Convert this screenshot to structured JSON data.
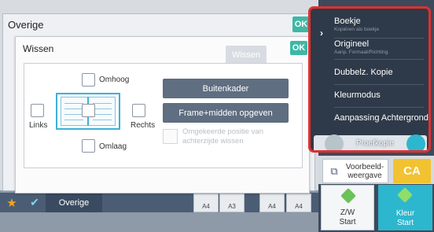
{
  "overige_panel": {
    "title": "Overige",
    "ok_label": "OK"
  },
  "wissen_dialog": {
    "title": "Wissen",
    "wissen_button": "Wissen",
    "ok_label": "OK",
    "checkboxes": {
      "top": "Omhoog",
      "left": "Links",
      "right": "Rechts",
      "bottom": "Omlaag"
    },
    "buttons": {
      "frame": "Buitenkader",
      "frame_center": "Frame+midden opgeven"
    },
    "reverse_side_label": "Omgekeerde positie van achterzijde wissen"
  },
  "menu": {
    "items": [
      {
        "label": "Boekje",
        "sub": "Kopiëren als boekje"
      },
      {
        "label": "Origineel",
        "sub": "Aanp. Formaat/Richting."
      },
      {
        "label": "Dubbelz. Kopie",
        "sub": ""
      },
      {
        "label": "Kleurmodus",
        "sub": ""
      },
      {
        "label": "Aanpassing Achtergrond",
        "sub": ""
      }
    ],
    "proof_label": "Proefkopie",
    "highlight_color": "#e0302f"
  },
  "right_panel": {
    "preview_label": "Voorbeeld-weergave",
    "ca_label": "CA",
    "start_bw_label": "Z/W\nStart",
    "start_color_label": "Kleur\nStart"
  },
  "bottom_bar": {
    "overige_label": "Overige",
    "paper_labels": [
      "A4",
      "A3",
      "A4",
      "A4"
    ]
  },
  "colors": {
    "ok_accent": "#3db8a6",
    "action_button": "#5f6e80",
    "ca_button": "#f2c230",
    "color_start": "#2cb7cf"
  }
}
